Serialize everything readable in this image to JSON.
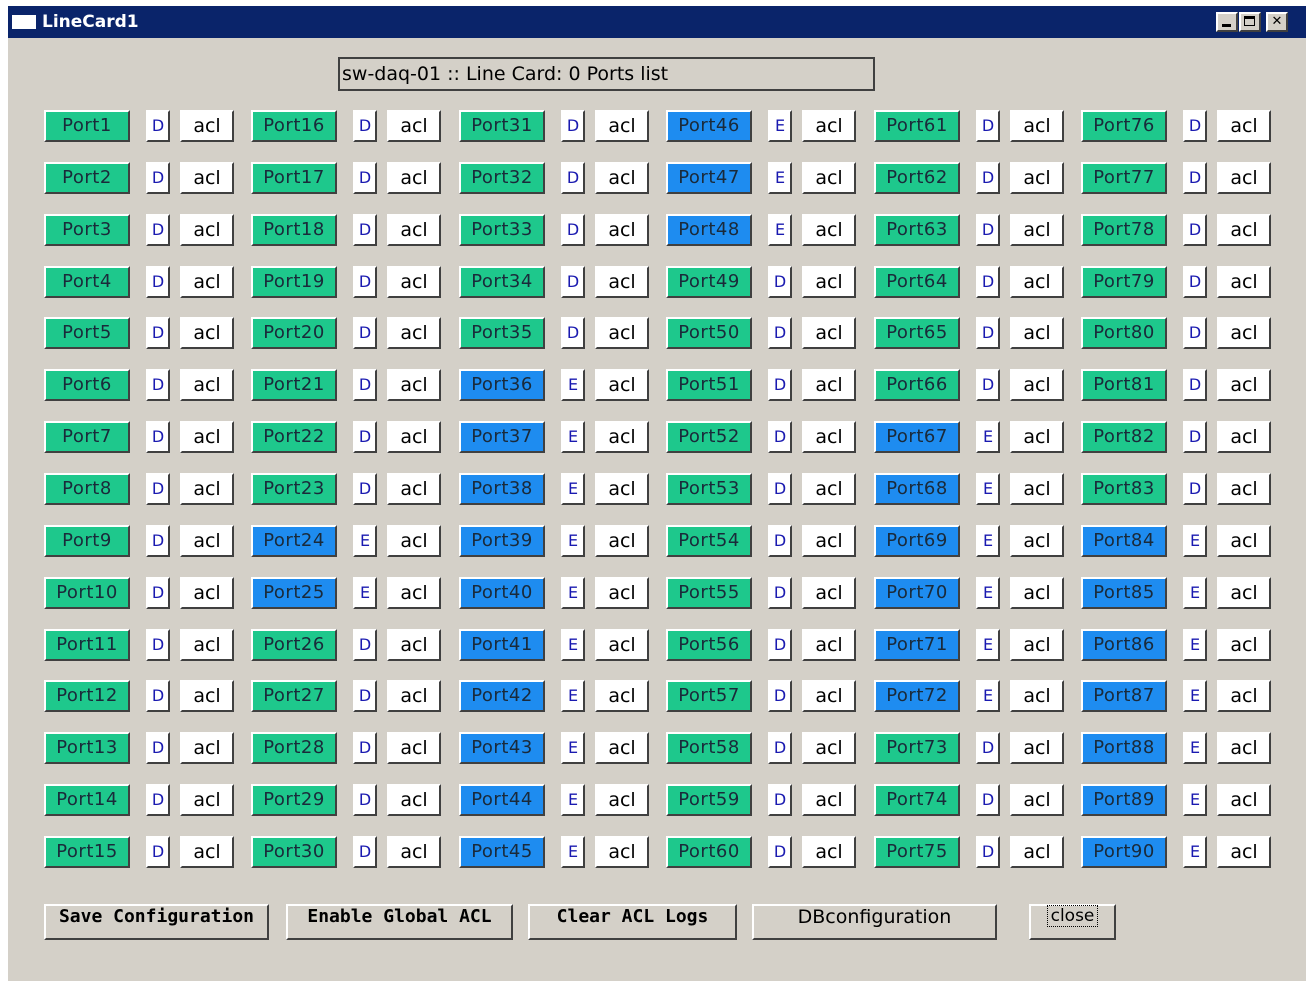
{
  "window": {
    "title": "LineCard1"
  },
  "header": {
    "text": "sw-daq-01 :: Line Card: 0 Ports list"
  },
  "colors": {
    "disabled_port": "#1ec88c",
    "enabled_port": "#1e8cf0"
  },
  "acl_label": "acl",
  "columns": [
    [
      {
        "label": "Port1",
        "state": "D"
      },
      {
        "label": "Port2",
        "state": "D"
      },
      {
        "label": "Port3",
        "state": "D"
      },
      {
        "label": "Port4",
        "state": "D"
      },
      {
        "label": "Port5",
        "state": "D"
      },
      {
        "label": "Port6",
        "state": "D"
      },
      {
        "label": "Port7",
        "state": "D"
      },
      {
        "label": "Port8",
        "state": "D"
      },
      {
        "label": "Port9",
        "state": "D"
      },
      {
        "label": "Port10",
        "state": "D"
      },
      {
        "label": "Port11",
        "state": "D"
      },
      {
        "label": "Port12",
        "state": "D"
      },
      {
        "label": "Port13",
        "state": "D"
      },
      {
        "label": "Port14",
        "state": "D"
      },
      {
        "label": "Port15",
        "state": "D"
      }
    ],
    [
      {
        "label": "Port16",
        "state": "D"
      },
      {
        "label": "Port17",
        "state": "D"
      },
      {
        "label": "Port18",
        "state": "D"
      },
      {
        "label": "Port19",
        "state": "D"
      },
      {
        "label": "Port20",
        "state": "D"
      },
      {
        "label": "Port21",
        "state": "D"
      },
      {
        "label": "Port22",
        "state": "D"
      },
      {
        "label": "Port23",
        "state": "D"
      },
      {
        "label": "Port24",
        "state": "E"
      },
      {
        "label": "Port25",
        "state": "E"
      },
      {
        "label": "Port26",
        "state": "D"
      },
      {
        "label": "Port27",
        "state": "D"
      },
      {
        "label": "Port28",
        "state": "D"
      },
      {
        "label": "Port29",
        "state": "D"
      },
      {
        "label": "Port30",
        "state": "D"
      }
    ],
    [
      {
        "label": "Port31",
        "state": "D"
      },
      {
        "label": "Port32",
        "state": "D"
      },
      {
        "label": "Port33",
        "state": "D"
      },
      {
        "label": "Port34",
        "state": "D"
      },
      {
        "label": "Port35",
        "state": "D"
      },
      {
        "label": "Port36",
        "state": "E"
      },
      {
        "label": "Port37",
        "state": "E"
      },
      {
        "label": "Port38",
        "state": "E"
      },
      {
        "label": "Port39",
        "state": "E"
      },
      {
        "label": "Port40",
        "state": "E"
      },
      {
        "label": "Port41",
        "state": "E"
      },
      {
        "label": "Port42",
        "state": "E"
      },
      {
        "label": "Port43",
        "state": "E"
      },
      {
        "label": "Port44",
        "state": "E"
      },
      {
        "label": "Port45",
        "state": "E"
      }
    ],
    [
      {
        "label": "Port46",
        "state": "E"
      },
      {
        "label": "Port47",
        "state": "E"
      },
      {
        "label": "Port48",
        "state": "E"
      },
      {
        "label": "Port49",
        "state": "D"
      },
      {
        "label": "Port50",
        "state": "D"
      },
      {
        "label": "Port51",
        "state": "D"
      },
      {
        "label": "Port52",
        "state": "D"
      },
      {
        "label": "Port53",
        "state": "D"
      },
      {
        "label": "Port54",
        "state": "D"
      },
      {
        "label": "Port55",
        "state": "D"
      },
      {
        "label": "Port56",
        "state": "D"
      },
      {
        "label": "Port57",
        "state": "D"
      },
      {
        "label": "Port58",
        "state": "D"
      },
      {
        "label": "Port59",
        "state": "D"
      },
      {
        "label": "Port60",
        "state": "D"
      }
    ],
    [
      {
        "label": "Port61",
        "state": "D"
      },
      {
        "label": "Port62",
        "state": "D"
      },
      {
        "label": "Port63",
        "state": "D"
      },
      {
        "label": "Port64",
        "state": "D"
      },
      {
        "label": "Port65",
        "state": "D"
      },
      {
        "label": "Port66",
        "state": "D"
      },
      {
        "label": "Port67",
        "state": "E"
      },
      {
        "label": "Port68",
        "state": "E"
      },
      {
        "label": "Port69",
        "state": "E"
      },
      {
        "label": "Port70",
        "state": "E"
      },
      {
        "label": "Port71",
        "state": "E"
      },
      {
        "label": "Port72",
        "state": "E"
      },
      {
        "label": "Port73",
        "state": "D"
      },
      {
        "label": "Port74",
        "state": "D"
      },
      {
        "label": "Port75",
        "state": "D"
      }
    ],
    [
      {
        "label": "Port76",
        "state": "D"
      },
      {
        "label": "Port77",
        "state": "D"
      },
      {
        "label": "Port78",
        "state": "D"
      },
      {
        "label": "Port79",
        "state": "D"
      },
      {
        "label": "Port80",
        "state": "D"
      },
      {
        "label": "Port81",
        "state": "D"
      },
      {
        "label": "Port82",
        "state": "D"
      },
      {
        "label": "Port83",
        "state": "D"
      },
      {
        "label": "Port84",
        "state": "E"
      },
      {
        "label": "Port85",
        "state": "E"
      },
      {
        "label": "Port86",
        "state": "E"
      },
      {
        "label": "Port87",
        "state": "E"
      },
      {
        "label": "Port88",
        "state": "E"
      },
      {
        "label": "Port89",
        "state": "E"
      },
      {
        "label": "Port90",
        "state": "E"
      }
    ]
  ],
  "buttons": {
    "save": "Save Configuration",
    "enable_acl": "Enable Global ACL",
    "clear_logs": "Clear ACL Logs",
    "db": "DBconfiguration",
    "close": "close"
  }
}
